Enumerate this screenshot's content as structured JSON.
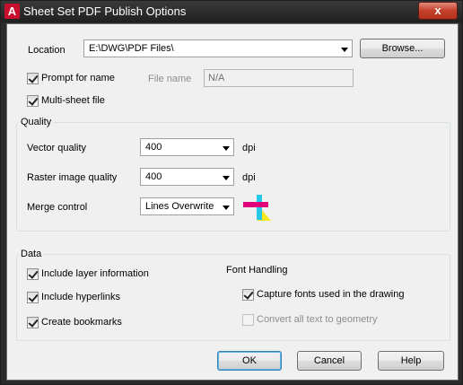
{
  "window": {
    "title": "Sheet Set PDF Publish Options",
    "close_label": "x"
  },
  "location": {
    "label": "Location",
    "value": "E:\\DWG\\PDF Files\\",
    "browse_label": "Browse..."
  },
  "prompt": {
    "label": "Prompt for name",
    "checked": true
  },
  "filename": {
    "label": "File name",
    "value": "N/A"
  },
  "multisheet": {
    "label": "Multi-sheet file",
    "checked": true
  },
  "quality": {
    "group_label": "Quality",
    "vector_label": "Vector quality",
    "vector_value": "400",
    "vector_unit": "dpi",
    "raster_label": "Raster image quality",
    "raster_value": "400",
    "raster_unit": "dpi",
    "merge_label": "Merge control",
    "merge_value": "Lines Overwrite"
  },
  "data": {
    "group_label": "Data",
    "include_layer": "Include layer information",
    "include_hyperlinks": "Include hyperlinks",
    "create_bookmarks": "Create bookmarks"
  },
  "font_handling": {
    "label": "Font Handling",
    "capture_fonts": "Capture fonts used in the drawing",
    "convert_text": "Convert all text to geometry"
  },
  "buttons": {
    "ok": "OK",
    "cancel": "Cancel",
    "help": "Help"
  },
  "colors": {
    "merge_icon_pink": "#e0007a",
    "merge_icon_cyan": "#26c9e8",
    "merge_icon_yellow": "#f7e61e"
  }
}
